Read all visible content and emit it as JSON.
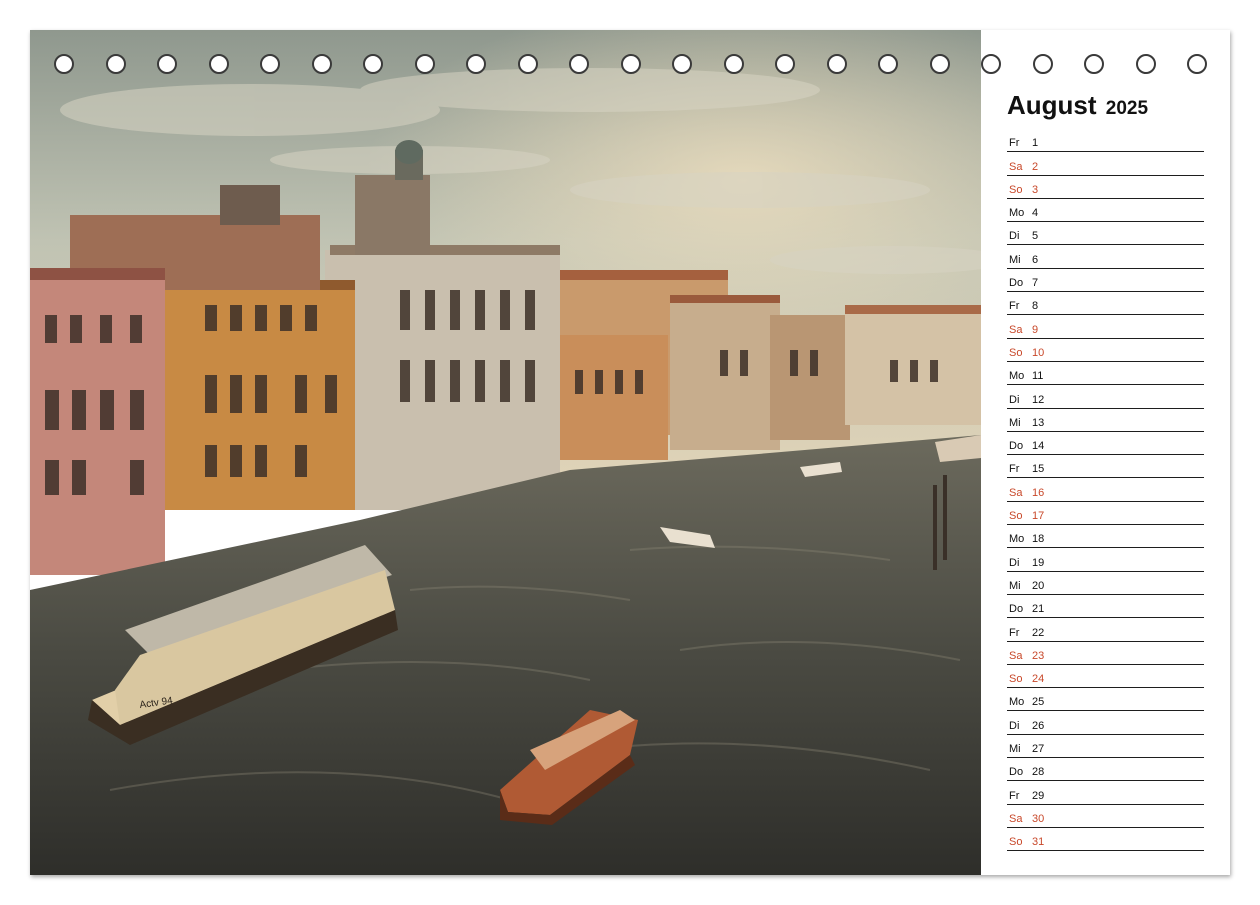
{
  "calendar": {
    "month": "August",
    "year": "2025",
    "weekend_color": "#c8482a",
    "days": [
      {
        "wd": "Fr",
        "d": "1",
        "weekend": false
      },
      {
        "wd": "Sa",
        "d": "2",
        "weekend": true
      },
      {
        "wd": "So",
        "d": "3",
        "weekend": true
      },
      {
        "wd": "Mo",
        "d": "4",
        "weekend": false
      },
      {
        "wd": "Di",
        "d": "5",
        "weekend": false
      },
      {
        "wd": "Mi",
        "d": "6",
        "weekend": false
      },
      {
        "wd": "Do",
        "d": "7",
        "weekend": false
      },
      {
        "wd": "Fr",
        "d": "8",
        "weekend": false
      },
      {
        "wd": "Sa",
        "d": "9",
        "weekend": true
      },
      {
        "wd": "So",
        "d": "10",
        "weekend": true
      },
      {
        "wd": "Mo",
        "d": "11",
        "weekend": false
      },
      {
        "wd": "Di",
        "d": "12",
        "weekend": false
      },
      {
        "wd": "Mi",
        "d": "13",
        "weekend": false
      },
      {
        "wd": "Do",
        "d": "14",
        "weekend": false
      },
      {
        "wd": "Fr",
        "d": "15",
        "weekend": false
      },
      {
        "wd": "Sa",
        "d": "16",
        "weekend": true
      },
      {
        "wd": "So",
        "d": "17",
        "weekend": true
      },
      {
        "wd": "Mo",
        "d": "18",
        "weekend": false
      },
      {
        "wd": "Di",
        "d": "19",
        "weekend": false
      },
      {
        "wd": "Mi",
        "d": "20",
        "weekend": false
      },
      {
        "wd": "Do",
        "d": "21",
        "weekend": false
      },
      {
        "wd": "Fr",
        "d": "22",
        "weekend": false
      },
      {
        "wd": "Sa",
        "d": "23",
        "weekend": true
      },
      {
        "wd": "So",
        "d": "24",
        "weekend": true
      },
      {
        "wd": "Mo",
        "d": "25",
        "weekend": false
      },
      {
        "wd": "Di",
        "d": "26",
        "weekend": false
      },
      {
        "wd": "Mi",
        "d": "27",
        "weekend": false
      },
      {
        "wd": "Do",
        "d": "28",
        "weekend": false
      },
      {
        "wd": "Fr",
        "d": "29",
        "weekend": false
      },
      {
        "wd": "Sa",
        "d": "30",
        "weekend": true
      },
      {
        "wd": "So",
        "d": "31",
        "weekend": true
      }
    ]
  },
  "photo": {
    "boat_label": "Actv 94"
  },
  "binding": {
    "ring_count": 23
  }
}
